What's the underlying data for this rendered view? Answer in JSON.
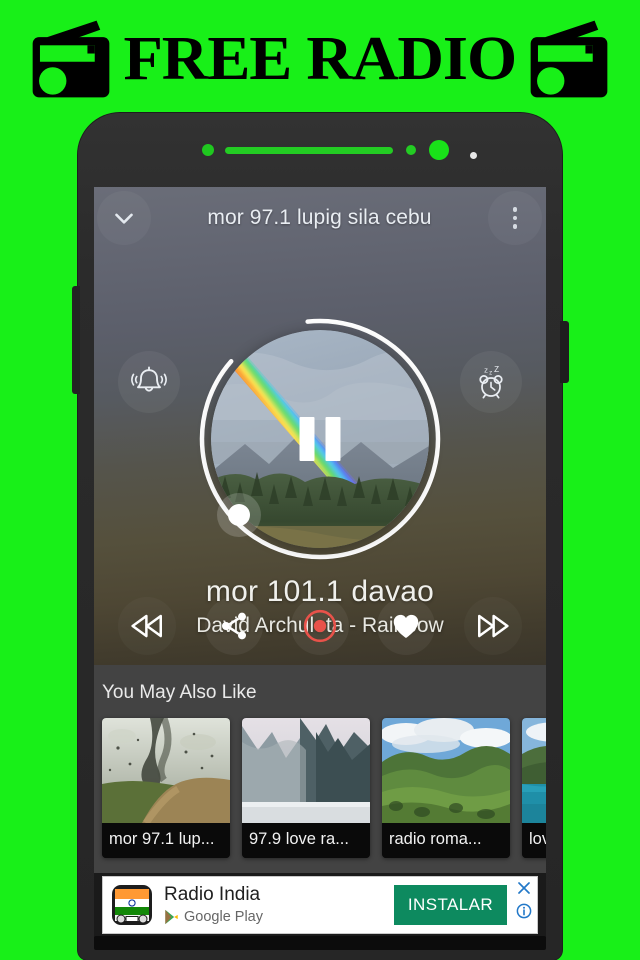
{
  "banner": {
    "title": "FREE RADIO",
    "background_color": "#18f018",
    "left_icon": "radio-icon",
    "right_icon": "radio-icon"
  },
  "phone": {
    "frame_color": "#2a2a2a",
    "accent_color": "#19e219",
    "notch": {
      "dot_left": "indicator-dot",
      "speaker": "earpiece-speaker",
      "dot_right_small": "indicator-dot",
      "dot_right_large": "front-camera",
      "dot_white": "sensor-dot"
    }
  },
  "app": {
    "appbar": {
      "back_icon": "chevron-down-icon",
      "title": "mor 97.1 lupig sila cebu",
      "overflow_icon": "more-vertical-icon"
    },
    "player": {
      "left_icon": "bell-icon",
      "right_icon": "sleep-timer-icon",
      "sleep_label": "zZZ",
      "play_state_icon": "pause-icon",
      "progress_percent": 88,
      "station": "mor 101.1 davao",
      "track": "David Archuleta - Rainbow",
      "artwork": "rainbow-over-forest-photo"
    },
    "controls": [
      {
        "name": "previous-button",
        "icon": "rewind-icon",
        "label": "Previous"
      },
      {
        "name": "share-button",
        "icon": "share-icon",
        "label": "Share"
      },
      {
        "name": "record-button",
        "icon": "record-icon",
        "label": "Record",
        "color": "#e8524a"
      },
      {
        "name": "favorite-button",
        "icon": "heart-icon",
        "label": "Favorite"
      },
      {
        "name": "next-button",
        "icon": "fast-forward-icon",
        "label": "Next"
      }
    ],
    "suggestions": {
      "title": "You May Also Like",
      "cards": [
        {
          "label": "mor 97.1 lup...",
          "thumb": "storm-road-photo"
        },
        {
          "label": "97.9 love ra...",
          "thumb": "mountain-fjord-photo"
        },
        {
          "label": "radio roma...",
          "thumb": "green-valley-photo"
        },
        {
          "label": "lov",
          "thumb": "lake-mountain-photo"
        }
      ]
    },
    "ad": {
      "icon": "radio-india-app-icon",
      "title": "Radio India",
      "source": "Google Play",
      "source_icon": "google-play-icon",
      "cta": "INSTALAR",
      "close_icon": "close-icon",
      "info_icon": "info-icon",
      "cta_color": "#0d8a5f"
    }
  }
}
